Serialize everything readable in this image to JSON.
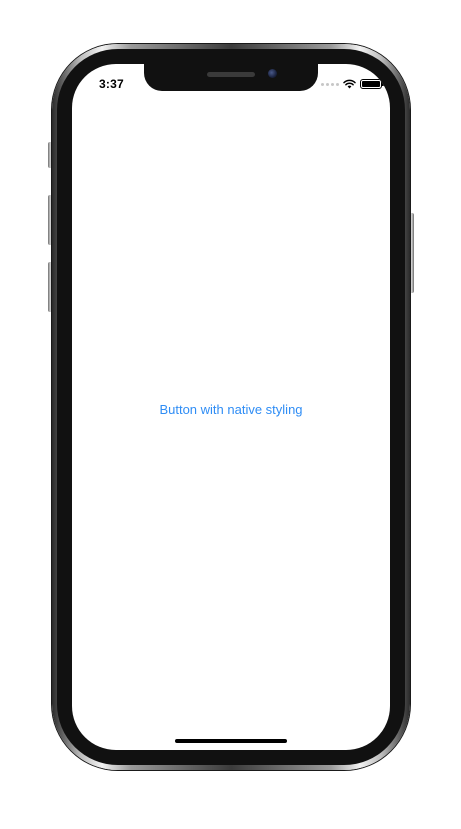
{
  "status_bar": {
    "time": "3:37",
    "icons": [
      "cellular-signal-icon",
      "wifi-icon",
      "battery-icon"
    ],
    "battery_level_fraction": 1.0
  },
  "main": {
    "button_label": "Button with native styling"
  },
  "colors": {
    "accent": "#2f8df5",
    "screen_background": "#ffffff",
    "device_bezel": "#111111"
  }
}
